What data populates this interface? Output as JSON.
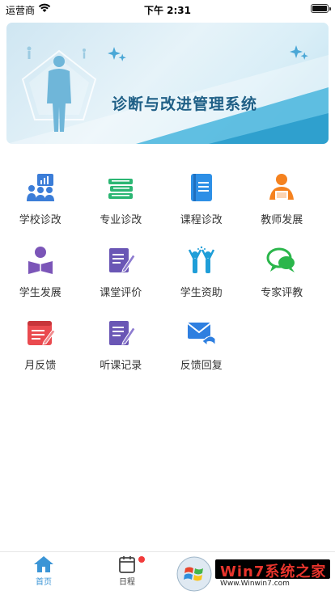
{
  "status_bar": {
    "carrier": "运营商",
    "time": "下午 2:31",
    "wifi_icon": "wifi-icon",
    "battery_icon": "battery-icon"
  },
  "banner": {
    "title": "诊断与改进管理系统"
  },
  "menu": {
    "items": [
      {
        "label": "学校诊改",
        "icon": "school-stats-icon",
        "color": "#3b7dd8"
      },
      {
        "label": "专业诊改",
        "icon": "books-stack-icon",
        "color": "#2bb673"
      },
      {
        "label": "课程诊改",
        "icon": "course-book-icon",
        "color": "#2d8fe6"
      },
      {
        "label": "教师发展",
        "icon": "teacher-icon",
        "color": "#f5821f"
      },
      {
        "label": "学生发展",
        "icon": "student-reading-icon",
        "color": "#7b55b8"
      },
      {
        "label": "课堂评价",
        "icon": "edit-note-icon",
        "color": "#6a56b5"
      },
      {
        "label": "学生资助",
        "icon": "students-cheer-icon",
        "color": "#1f9ed8"
      },
      {
        "label": "专家评教",
        "icon": "chat-bubbles-icon",
        "color": "#2bb64b"
      },
      {
        "label": "月反馈",
        "icon": "month-feedback-icon",
        "color": "#ea4a4f"
      },
      {
        "label": "听课记录",
        "icon": "class-record-icon",
        "color": "#6a56b5"
      },
      {
        "label": "反馈回复",
        "icon": "mail-reply-icon",
        "color": "#2e7fe0"
      }
    ]
  },
  "tab_bar": {
    "home_label": "首页",
    "schedule_label": "日程",
    "accent": "#3b95d6",
    "badge_color": "#f23b3b"
  },
  "watermark": {
    "text": "Win7系统之家",
    "url": "Www.Winwin7.com"
  }
}
